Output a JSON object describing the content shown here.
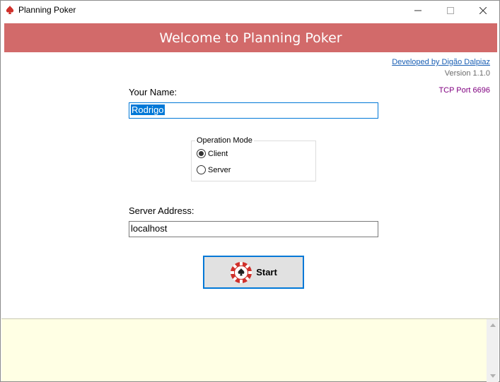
{
  "window": {
    "title": "Planning Poker",
    "icon": "spade-icon",
    "controls": {
      "minimize": "—",
      "maximize": "☐",
      "close": "✕"
    }
  },
  "banner": {
    "text": "Welcome to Planning Poker",
    "color": "#d26a6a"
  },
  "info": {
    "developer_link": "Developed by Digão Dalpiaz",
    "version": "Version 1.1.0",
    "port": "TCP Port 6696"
  },
  "form": {
    "name_label": "Your Name:",
    "name_value": "Rodrigo",
    "operation_mode": {
      "legend": "Operation Mode",
      "options": [
        "Client",
        "Server"
      ],
      "selected": "Client"
    },
    "server_label": "Server Address:",
    "server_value": "localhost",
    "start_label": "Start"
  },
  "log_panel": {
    "background": "#ffffe4",
    "content": ""
  },
  "colors": {
    "accent": "#0078d7",
    "banner": "#d26a6a",
    "port_text": "#800080",
    "link": "#1a5fb4"
  }
}
